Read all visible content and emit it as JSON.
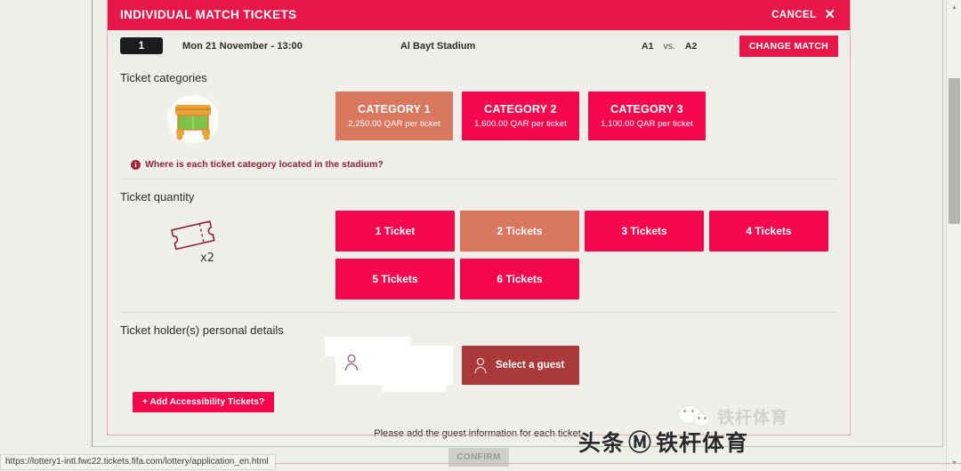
{
  "browser": {
    "status_url": "https://lottery1-intl.fwc22.tickets.fifa.com/lottery/application_en.html"
  },
  "modal": {
    "title": "INDIVIDUAL MATCH TICKETS",
    "cancel_label": "CANCEL",
    "close_icon": "close-x-icon"
  },
  "match": {
    "number": "1",
    "date": "Mon 21 November - 13:00",
    "stadium": "Al Bayt Stadium",
    "home_team": "A1",
    "vs": "vs.",
    "away_team": "A2",
    "change_match_label": "CHANGE MATCH"
  },
  "categories": {
    "section_title": "Ticket categories",
    "icon": "stadium-icon",
    "info_link": "Where is each ticket category located in the stadium?",
    "info_icon": "info-circle-icon",
    "selected_index": 0,
    "items": [
      {
        "name": "CATEGORY 1",
        "price": "2,250.00 QAR per ticket"
      },
      {
        "name": "CATEGORY 2",
        "price": "1,600.00 QAR per ticket"
      },
      {
        "name": "CATEGORY 3",
        "price": "1,100.00 QAR per ticket"
      }
    ]
  },
  "quantity": {
    "section_title": "Ticket quantity",
    "icon": "ticket-icon",
    "icon_badge": "x2",
    "selected_index": 1,
    "options": [
      "1 Ticket",
      "2 Tickets",
      "3 Tickets",
      "4 Tickets",
      "5 Tickets",
      "6 Tickets"
    ]
  },
  "holders": {
    "section_title": "Ticket holder(s) personal details",
    "slot_1_value": "",
    "slot_1_icon": "person-icon",
    "select_guest_label": "Select a guest",
    "select_guest_icon": "person-icon",
    "accessibility_label": "+ Add Accessibility Tickets?"
  },
  "footer": {
    "note": "Please add the guest information for each ticket.",
    "confirm_label": "CONFIRM"
  },
  "watermark": {
    "prefix": "头条",
    "at": "@",
    "handle": "铁杆体育",
    "ghost_handle": "铁杆体育"
  },
  "colors": {
    "brand_pink": "#f5074e",
    "header_pink": "#e8174a",
    "selected_salmon": "#d9785f",
    "guest_red": "#a93a39",
    "page_bg": "#efeee8"
  }
}
